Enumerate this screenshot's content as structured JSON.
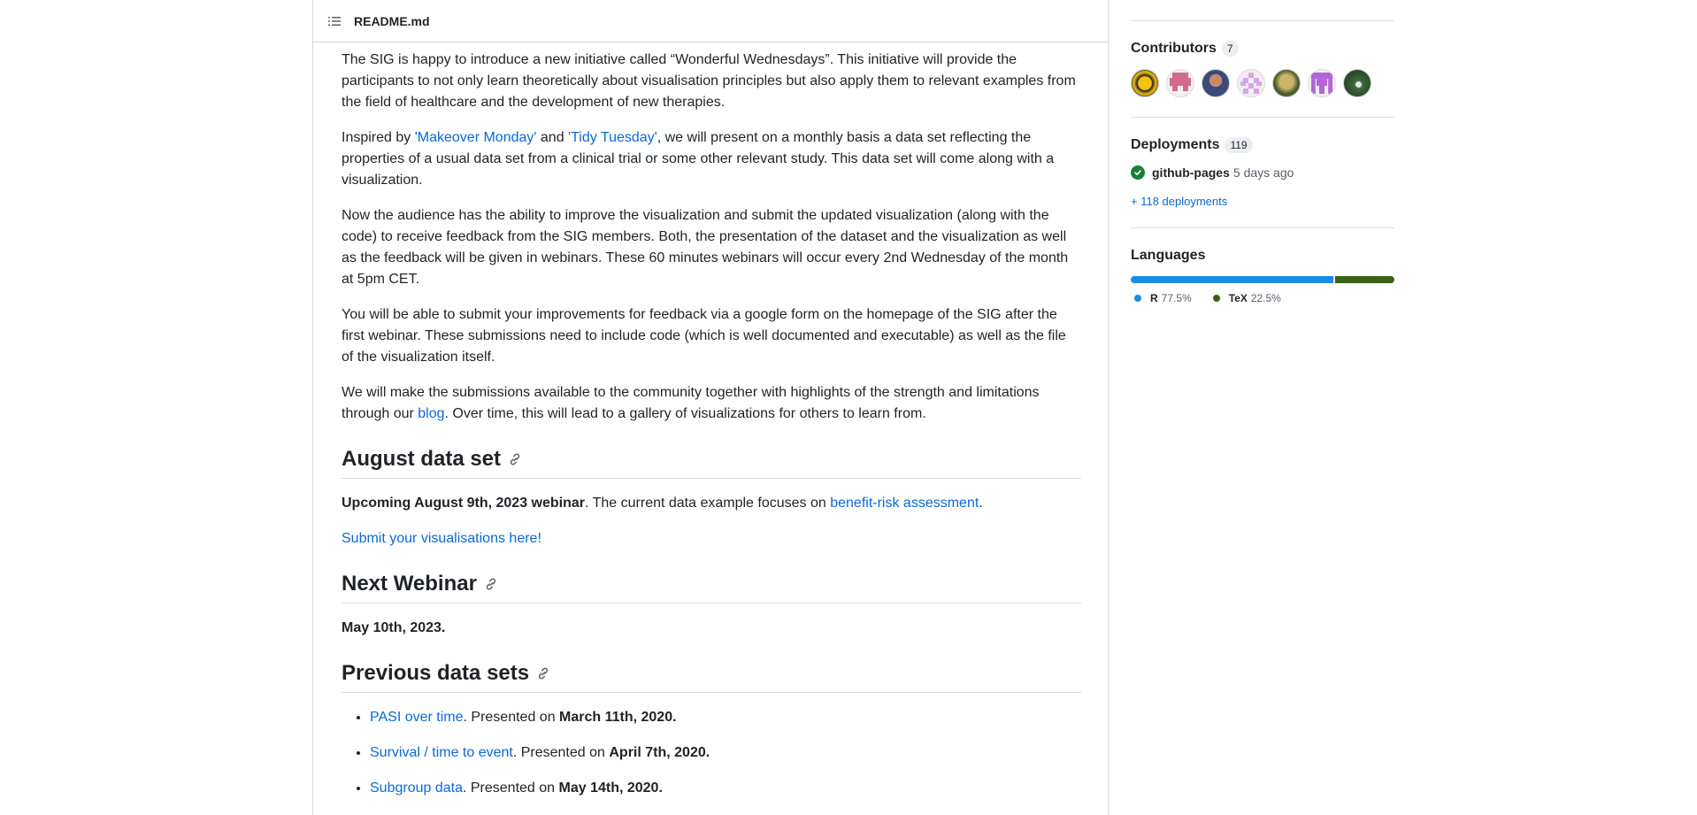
{
  "readme": {
    "title": "README.md",
    "paragraphs": {
      "p1": "The SIG is happy to introduce a new initiative called “Wonderful Wednesdays”. This initiative will provide the participants to not only learn theoretically about visualisation principles but also apply them to relevant examples from the field of healthcare and the development of new therapies.",
      "p2_pre": "Inspired by ",
      "p2_link1": "'Makeover Monday'",
      "p2_mid": " and ",
      "p2_link2": "'Tidy Tuesday'",
      "p2_post": ", we will present on a monthly basis a data set reflecting the properties of a usual data set from a clinical trial or some other relevant study. This data set will come along with a visualization.",
      "p3": "Now the audience has the ability to improve the visualization and submit the updated visualization (along with the code) to receive feedback from the SIG members. Both, the presentation of the dataset and the visualization as well as the feedback will be given in webinars. These 60 minutes webinars will occur every 2nd Wednesday of the month at 5pm CET.",
      "p4": "You will be able to submit your improvements for feedback via a google form on the homepage of the SIG after the first webinar. These submissions need to include code (which is well documented and executable) as well as the file of the visualization itself.",
      "p5_pre": "We will make the submissions available to the community together with highlights of the strength and limitations through our ",
      "p5_link": "blog",
      "p5_post": ". Over time, this will lead to a gallery of visualizations for others to learn from."
    },
    "august": {
      "heading": "August data set",
      "strong": "Upcoming August 9th, 2023 webinar",
      "text": ". The current data example focuses on ",
      "link": "benefit-risk assessment",
      "end": ".",
      "submit_link": "Submit your visualisations here!"
    },
    "next": {
      "heading": "Next Webinar",
      "date": "May 10th, 2023."
    },
    "previous": {
      "heading": "Previous data sets",
      "presented_on": ". Presented on ",
      "items": [
        {
          "link": "PASI over time",
          "date": "March 11th, 2020."
        },
        {
          "link": "Survival / time to event",
          "date": "April 7th, 2020."
        },
        {
          "link": "Subgroup data",
          "date": "May 14th, 2020."
        }
      ]
    }
  },
  "sidebar": {
    "contributors": {
      "title": "Contributors",
      "count": "7"
    },
    "deployments": {
      "title": "Deployments",
      "count": "119",
      "env": "github-pages",
      "time": "5 days ago",
      "more": "+ 118 deployments"
    },
    "languages": {
      "title": "Languages",
      "items": [
        {
          "name": "R",
          "pct": "77.5%",
          "value": 77.5,
          "color": "#198ce7"
        },
        {
          "name": "TeX",
          "pct": "22.5%",
          "value": 22.5,
          "color": "#3d6117"
        }
      ]
    }
  },
  "colors": {
    "link": "#0969da",
    "success": "#1a7f37"
  },
  "icons": [
    "list-icon",
    "link-icon",
    "check-circle-icon"
  ]
}
